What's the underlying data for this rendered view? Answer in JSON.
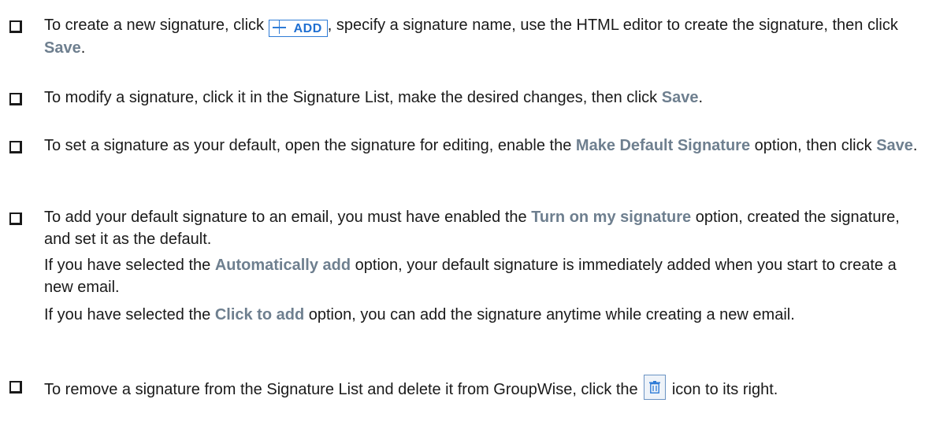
{
  "items": [
    {
      "pre": "To create a new signature, click",
      "button_label": "ADD",
      "mid": ", specify a signature name, use the HTML editor to create the signature, then click",
      "ui": "Save",
      "post": "."
    },
    {
      "pre": "To modify a signature, click it in the Signature List, make the desired changes, then click",
      "ui": "Save",
      "post": "."
    },
    {
      "pre": "To set a signature as your default, open the signature for editing, enable the",
      "ui1": "Make Default Signature",
      "mid": "option, then click",
      "ui2": "Save",
      "post": "."
    },
    {
      "pre": "To add your default signature to an email, you must have enabled the",
      "ui": "Turn on my signature",
      "post": "option, created the signature, and set it as the default.",
      "para1": {
        "pre": "If you have selected the",
        "ui": "Automatically add",
        "post": "option, your default signature is immediately added when you start to create a new email."
      },
      "para2": {
        "pre": "If you have selected the",
        "ui": "Click to add",
        "post": "option, you can add the signature anytime while creating a new email."
      }
    },
    {
      "pre": "To remove a signature from the Signature List and delete it from GroupWise, click the",
      "post": "icon to its right.",
      "icon": "trash-icon"
    }
  ],
  "colors": {
    "ui_text": "#6e7f8f",
    "add_button": "#2e7bd6",
    "trash_button_border": "#6b93c3"
  }
}
